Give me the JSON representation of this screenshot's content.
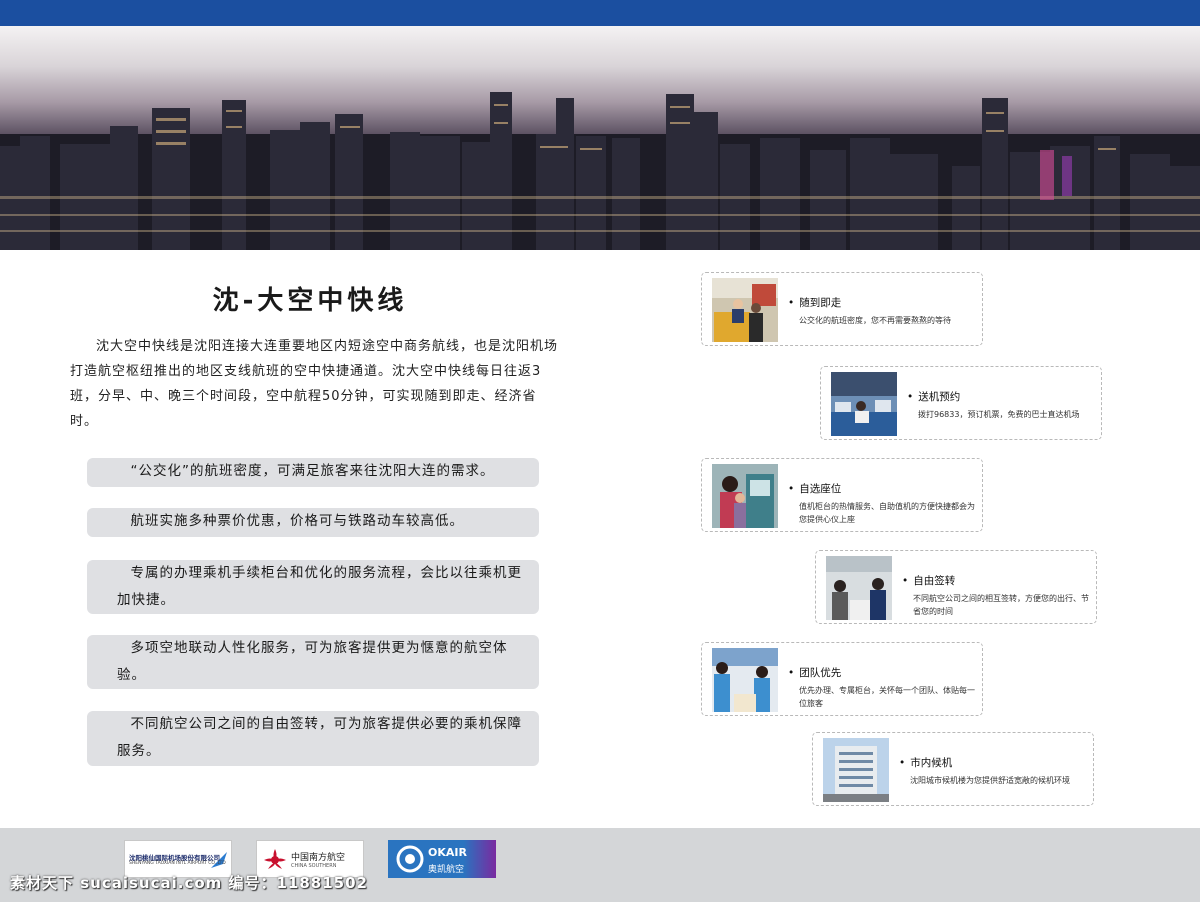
{
  "colors": {
    "top_bar": "#1b4fa0",
    "pill_bg": "#dfe0e3",
    "footer_bg": "#d4d6d8"
  },
  "title": "沈-大空中快线",
  "intro": "沈大空中快线是沈阳连接大连重要地区内短途空中商务航线，也是沈阳机场打造航空枢纽推出的地区支线航班的空中快捷通道。沈大空中快线每日往返3班，分早、中、晚三个时间段，空中航程50分钟，可实现随到即走、经济省时。",
  "features": [
    "“公交化”的航班密度，可满足旅客来往沈阳大连的需求。",
    "航班实施多种票价优惠，价格可与铁路动车较高低。",
    "专属的办理乘机手续柜台和优化的服务流程，会比以往乘机更加快捷。",
    "多项空地联动人性化服务，可为旅客提供更为惬意的航空体验。",
    "不同航空公司之间的自由签转，可为旅客提供必要的乘机保障服务。"
  ],
  "services": [
    {
      "title": "随到即走",
      "desc": "公交化的航班密度，您不再需要熬熬的等待",
      "photo_icon": "counter-photo"
    },
    {
      "title": "送机预约",
      "desc": "拨打96833，预订机票，免费的巴士直达机场",
      "photo_icon": "call-center-photo"
    },
    {
      "title": "自选座位",
      "desc": "值机柜台的热情服务、自助值机的方便快捷都会为您提供心仪上座",
      "photo_icon": "self-checkin-photo"
    },
    {
      "title": "自由签转",
      "desc": "不同航空公司之间的相互签转，方便您的出行、节省您的时间",
      "photo_icon": "transfer-desk-photo"
    },
    {
      "title": "团队优先",
      "desc": "优先办理、专属柜台，关怀每一个团队、体贴每一位旅客",
      "photo_icon": "group-service-photo"
    },
    {
      "title": "市内候机",
      "desc": "沈阳城市候机楼为您提供舒适宽敞的候机环境",
      "photo_icon": "terminal-building-photo"
    }
  ],
  "logos": [
    {
      "cn": "沈阳桃仙国际机场股份有限公司",
      "en": "SHENYANG TAOXIAN INTL AIRPORT CO.,LTD"
    },
    {
      "cn": "中国南方航空",
      "en": "CHINA SOUTHERN"
    },
    {
      "cn": "OKAIR",
      "en": "奥凯航空"
    }
  ],
  "watermark": "素材天下 sucaisucai.com    编号：11881502"
}
